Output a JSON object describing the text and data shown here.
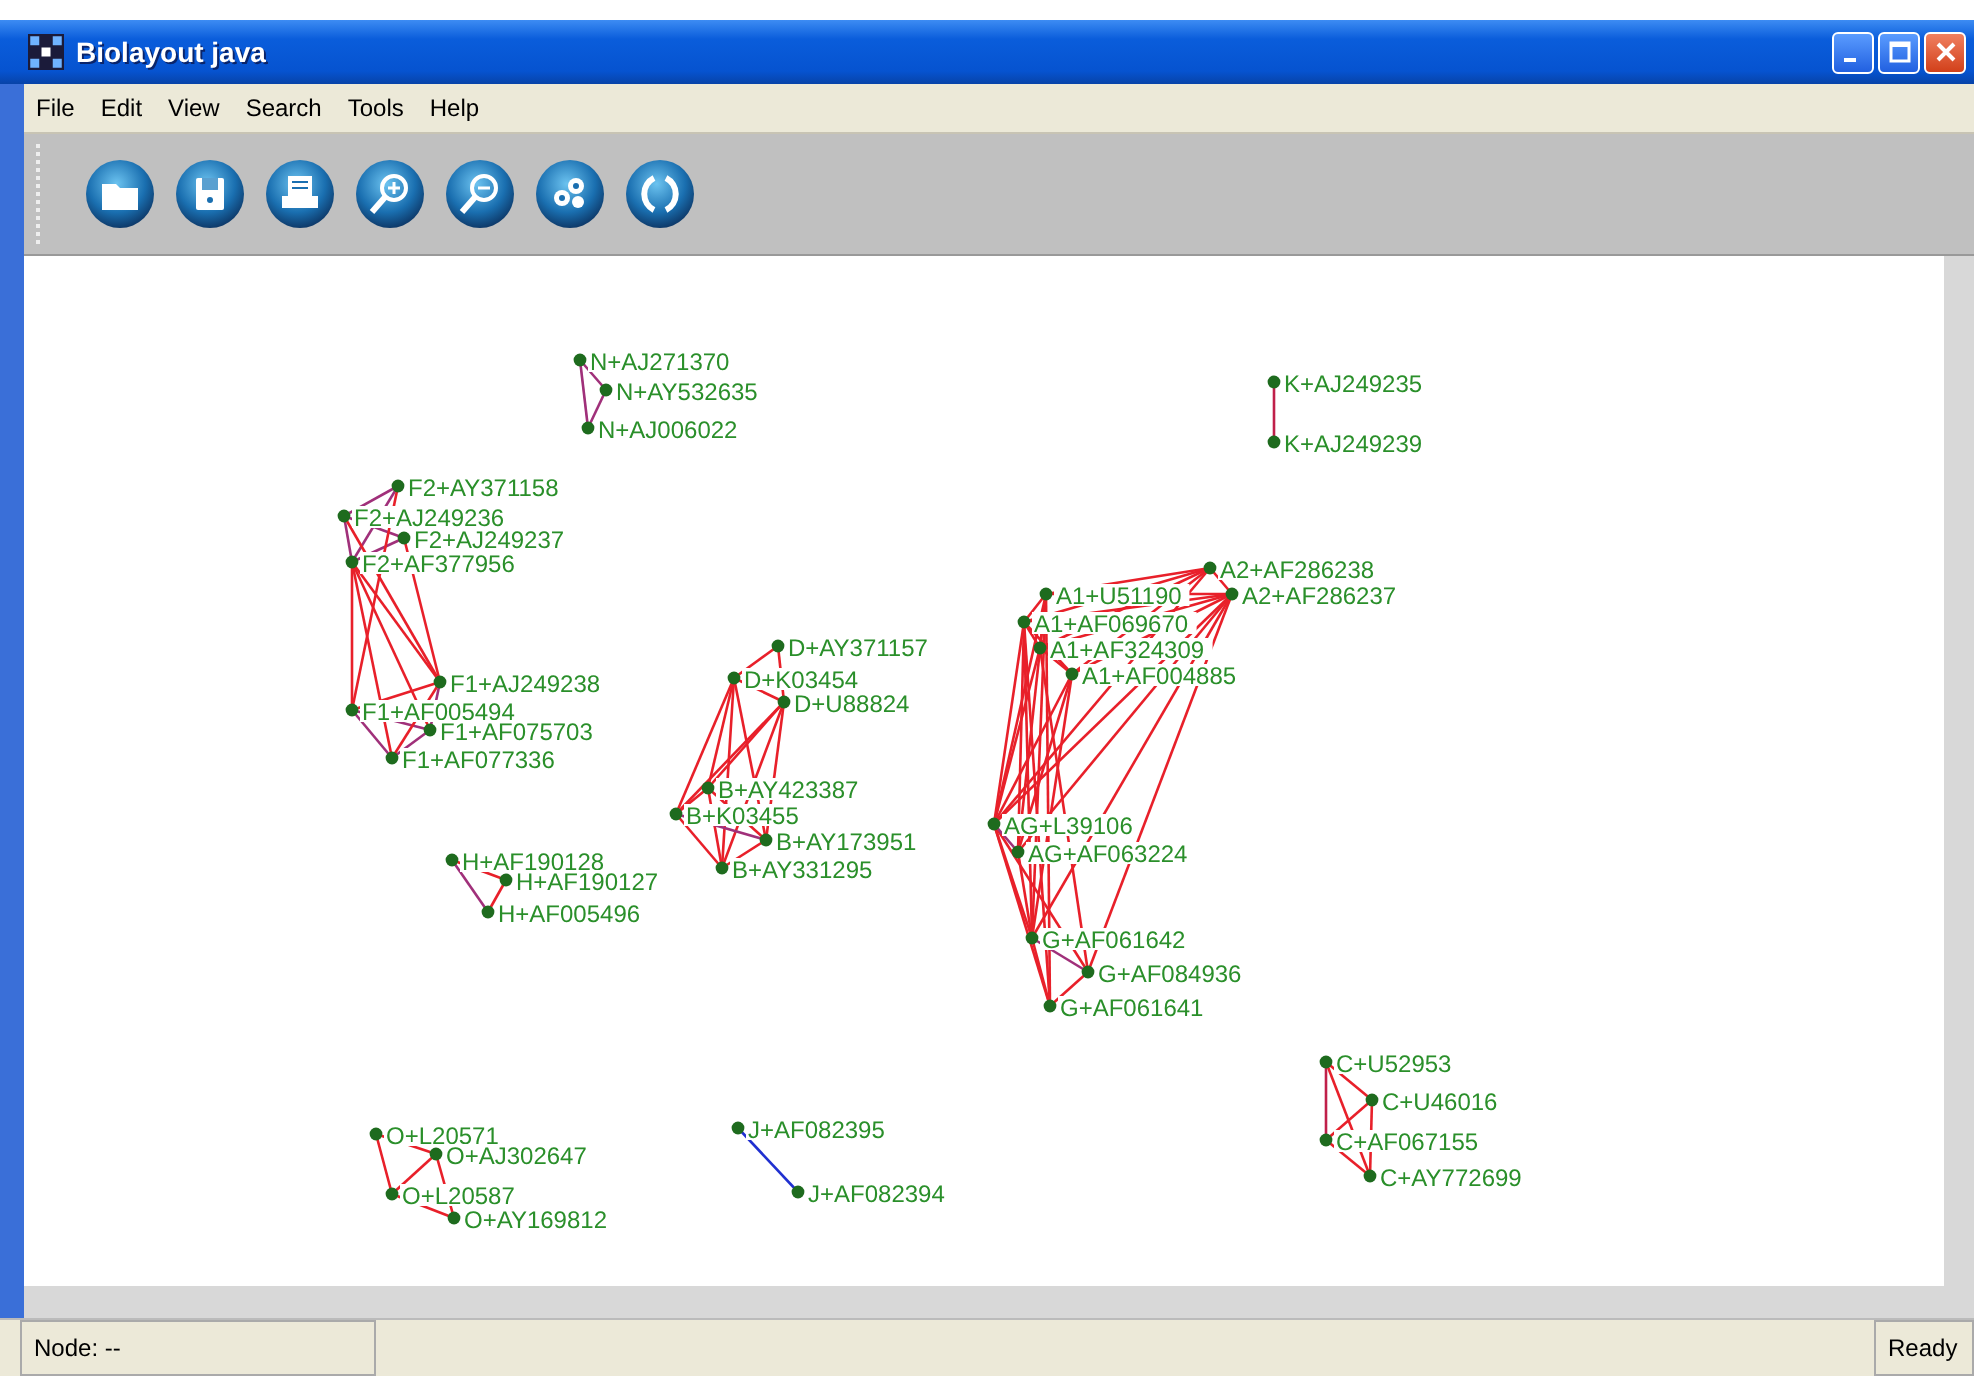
{
  "window": {
    "title": "Biolayout java"
  },
  "menu": [
    "File",
    "Edit",
    "View",
    "Search",
    "Tools",
    "Help"
  ],
  "graph": {
    "clusters": [
      {
        "nodes": [
          {
            "label": "N+AJ271370"
          },
          {
            "label": "N+AY532635"
          },
          {
            "label": "N+AJ006022"
          }
        ]
      },
      {
        "nodes": [
          {
            "label": "K+AJ249235"
          },
          {
            "label": "K+AJ249239"
          }
        ]
      },
      {
        "nodes": [
          {
            "label": "F2+AY371158"
          },
          {
            "label": "F2+AJ249236"
          },
          {
            "label": "F2+AJ249237"
          },
          {
            "label": "F2+AF377956"
          },
          {
            "label": "F1+AJ249238"
          },
          {
            "label": "F1+AF005494"
          },
          {
            "label": "F1+AF075703"
          },
          {
            "label": "F1+AF077336"
          }
        ]
      },
      {
        "nodes": [
          {
            "label": "D+AY371157"
          },
          {
            "label": "D+K03454"
          },
          {
            "label": "D+U88824"
          },
          {
            "label": "B+AY423387"
          },
          {
            "label": "B+K03455"
          },
          {
            "label": "B+AY173951"
          },
          {
            "label": "B+AY331295"
          }
        ]
      },
      {
        "nodes": [
          {
            "label": "H+AF190128"
          },
          {
            "label": "H+AF190127"
          },
          {
            "label": "H+AF005496"
          }
        ]
      },
      {
        "nodes": [
          {
            "label": "A2+AF286238"
          },
          {
            "label": "A2+AF286237"
          },
          {
            "label": "A1+U51190"
          },
          {
            "label": "A1+AF069670"
          },
          {
            "label": "A1+AF324309"
          },
          {
            "label": "A1+AF004885"
          },
          {
            "label": "AG+L39106"
          },
          {
            "label": "AG+AF063224"
          },
          {
            "label": "G+AF061642"
          },
          {
            "label": "G+AF084936"
          },
          {
            "label": "G+AF061641"
          }
        ]
      },
      {
        "nodes": [
          {
            "label": "C+U52953"
          },
          {
            "label": "C+U46016"
          },
          {
            "label": "C+AF067155"
          },
          {
            "label": "C+AY772699"
          }
        ]
      },
      {
        "nodes": [
          {
            "label": "O+L20571"
          },
          {
            "label": "O+AJ302647"
          },
          {
            "label": "O+L20587"
          },
          {
            "label": "O+AY169812"
          }
        ]
      },
      {
        "nodes": [
          {
            "label": "J+AF082395"
          },
          {
            "label": "J+AF082394"
          }
        ]
      }
    ]
  },
  "status_bar": {
    "node": "Node: --",
    "state": "Ready"
  }
}
